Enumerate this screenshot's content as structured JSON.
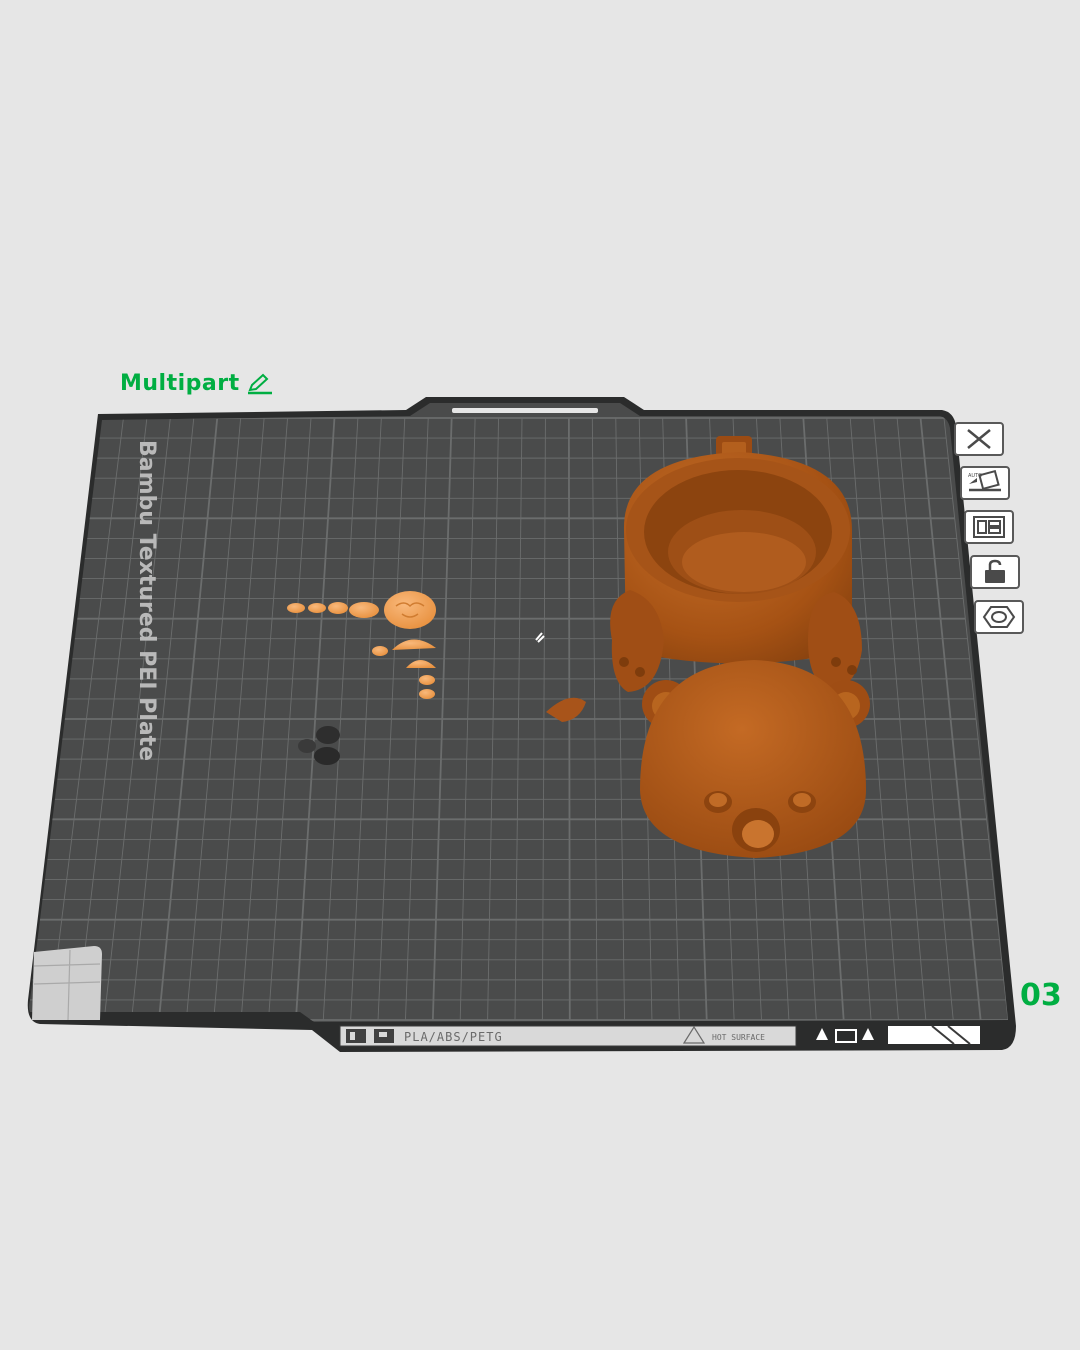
{
  "plate": {
    "name": "Multipart",
    "number": "03",
    "bed_texture_label": "Bambu Textured PEI Plate",
    "filament_label": "PLA/ABS/PETG",
    "hot_surface_label": "HOT SURFACE"
  },
  "toolbar": [
    {
      "name": "close-plate-button",
      "icon": "close-icon"
    },
    {
      "name": "auto-orient-button",
      "icon": "auto-orient-icon"
    },
    {
      "name": "arrange-button",
      "icon": "arrange-icon"
    },
    {
      "name": "lock-plate-button",
      "icon": "lock-open-icon"
    },
    {
      "name": "plate-settings-button",
      "icon": "hexagon-settings-icon"
    }
  ],
  "colors": {
    "accent": "#00ae42",
    "bed": "#4a4b4b",
    "bed_grid": "#6b6d6d",
    "bed_edge": "#2b2c2c",
    "model_main": "#b35a17",
    "model_parts": "#f4a25e",
    "model_dark": "#2d2d2d"
  }
}
